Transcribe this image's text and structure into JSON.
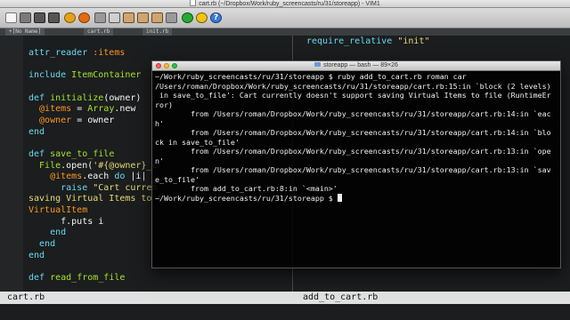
{
  "window": {
    "title": "cart.rb (~/Dropbox/Work/ruby_screencasts/ru/31/storeapp) - VIM1"
  },
  "toolbar": {
    "icons": [
      "document-icon",
      "open-icon",
      "save-icon",
      "save-all-icon",
      "print-icon",
      "undo-icon",
      "redo-icon",
      "cut-icon",
      "copy-icon",
      "paste-icon",
      "find-icon",
      "find-next-icon",
      "build-icon",
      "run-icon",
      "shell-icon",
      "help-icon"
    ]
  },
  "tabs": [
    {
      "label": "+[No Name]"
    },
    {
      "label": "cart.rb"
    },
    {
      "label": "init.rb"
    }
  ],
  "editor": {
    "lines": [
      {
        "parts": [
          {
            "t": "attr_reader ",
            "c": "kw"
          },
          {
            "t": ":items",
            "c": "sym"
          }
        ]
      },
      {
        "parts": [
          {
            "t": "",
            "c": ""
          }
        ]
      },
      {
        "parts": [
          {
            "t": "include ",
            "c": "kw"
          },
          {
            "t": "ItemContainer",
            "c": "cls"
          }
        ]
      },
      {
        "parts": [
          {
            "t": "",
            "c": ""
          }
        ]
      },
      {
        "parts": [
          {
            "t": "def ",
            "c": "kw"
          },
          {
            "t": "initialize",
            "c": "fn"
          },
          {
            "t": "(owner)",
            "c": ""
          }
        ]
      },
      {
        "parts": [
          {
            "t": "  @items",
            "c": "ivar"
          },
          {
            "t": " = ",
            "c": ""
          },
          {
            "t": "Array",
            "c": "cls"
          },
          {
            "t": ".new",
            "c": ""
          }
        ]
      },
      {
        "parts": [
          {
            "t": "  @owner",
            "c": "ivar"
          },
          {
            "t": " = owner",
            "c": ""
          }
        ]
      },
      {
        "parts": [
          {
            "t": "end",
            "c": "kw"
          }
        ]
      },
      {
        "parts": [
          {
            "t": "",
            "c": ""
          }
        ]
      },
      {
        "parts": [
          {
            "t": "def ",
            "c": "kw"
          },
          {
            "t": "save_to_file",
            "c": "fn"
          }
        ]
      },
      {
        "parts": [
          {
            "t": "  File",
            "c": "cls"
          },
          {
            "t": ".open(",
            "c": ""
          },
          {
            "t": "'#{@owner}_c",
            "c": "str"
          }
        ]
      },
      {
        "parts": [
          {
            "t": "    @items",
            "c": "ivar"
          },
          {
            "t": ".each ",
            "c": ""
          },
          {
            "t": "do",
            "c": "kw"
          },
          {
            "t": " |i|",
            "c": ""
          }
        ]
      },
      {
        "parts": [
          {
            "t": "      raise ",
            "c": "kw"
          },
          {
            "t": "\"Cart curren",
            "c": "str"
          }
        ]
      },
      {
        "parts": [
          {
            "t": "saving Virtual Items to f",
            "c": "str"
          }
        ]
      },
      {
        "parts": [
          {
            "t": "VirtualItem",
            "c": "err"
          }
        ]
      },
      {
        "parts": [
          {
            "t": "      f.puts i",
            "c": ""
          }
        ]
      },
      {
        "parts": [
          {
            "t": "    end",
            "c": "kw"
          }
        ]
      },
      {
        "parts": [
          {
            "t": "  end",
            "c": "kw"
          }
        ]
      },
      {
        "parts": [
          {
            "t": "end",
            "c": "kw"
          }
        ]
      },
      {
        "parts": [
          {
            "t": "",
            "c": ""
          }
        ]
      },
      {
        "parts": [
          {
            "t": "def ",
            "c": "kw"
          },
          {
            "t": "read_from_file",
            "c": "fn"
          }
        ]
      }
    ],
    "right_pane": {
      "keyword": "require_relative ",
      "string": "\"init\""
    }
  },
  "statusline": {
    "left": "cart.rb",
    "right": "add_to_cart.rb"
  },
  "terminal": {
    "title": "storeapp — bash — 89×26",
    "lines": [
      "~/Work/ruby_screencasts/ru/31/storeapp $ ruby add_to_cart.rb roman car",
      "/Users/roman/Dropbox/Work/ruby_screencasts/ru/31/storeapp/cart.rb:15:in `block (2 levels)",
      " in save_to_file': Cart currently doesn't support saving Virtual Items to file (RuntimeEr",
      "ror)",
      "        from /Users/roman/Dropbox/Work/ruby_screencasts/ru/31/storeapp/cart.rb:14:in `eac",
      "h'",
      "        from /Users/roman/Dropbox/Work/ruby_screencasts/ru/31/storeapp/cart.rb:14:in `blo",
      "ck in save_to_file'",
      "        from /Users/roman/Dropbox/Work/ruby_screencasts/ru/31/storeapp/cart.rb:13:in `ope",
      "n'",
      "        from /Users/roman/Dropbox/Work/ruby_screencasts/ru/31/storeapp/cart.rb:13:in `sav",
      "e_to_file'",
      "        from add_to_cart.rb:8:in `<main>'",
      "~/Work/ruby_screencasts/ru/31/storeapp $ "
    ]
  }
}
